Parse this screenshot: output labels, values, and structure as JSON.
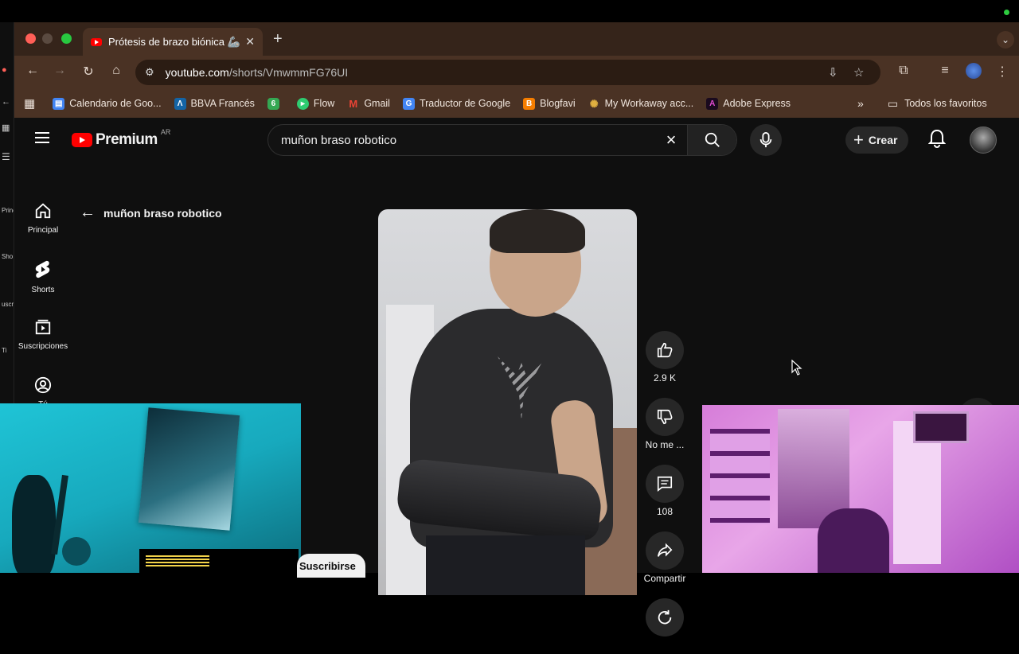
{
  "browser": {
    "tab_title": "Prótesis de brazo biónica 🦾",
    "tab_close": "✕",
    "new_tab": "+",
    "url_domain": "youtube.com",
    "url_path": "/shorts/VmwmmFG76UI"
  },
  "bookmarks": {
    "items": [
      {
        "label": "Calendario de Goo...",
        "icon": "calendar-icon",
        "color": "#4285f4"
      },
      {
        "label": "BBVA Francés",
        "icon": "bbva-icon",
        "color": "#1464a5"
      },
      {
        "label": "",
        "icon": "six-badge-icon",
        "color": "#34a853",
        "badge": "6"
      },
      {
        "label": "Flow",
        "icon": "flow-icon",
        "color": "#2ecc71"
      },
      {
        "label": "Gmail",
        "icon": "gmail-icon",
        "color": "#ea4335"
      },
      {
        "label": "Traductor de Google",
        "icon": "translate-icon",
        "color": "#4285f4"
      },
      {
        "label": "Blogfavi",
        "icon": "blogger-icon",
        "color": "#f57d00"
      },
      {
        "label": "My Workaway acc...",
        "icon": "workaway-icon",
        "color": "#e0b040"
      },
      {
        "label": "Adobe Express",
        "icon": "adobe-express-icon",
        "color": "#8b1d9c"
      }
    ],
    "more": "»",
    "all_favorites": "Todos los favoritos"
  },
  "youtube": {
    "logo_text": "Premium",
    "country_code": "AR",
    "search_query": "muñon braso robotico",
    "create_label": "Crear",
    "back_label": "muñon braso robotico",
    "guide": [
      {
        "label": "Principal",
        "icon": "home-icon"
      },
      {
        "label": "Shorts",
        "icon": "shorts-icon"
      },
      {
        "label": "Suscripciones",
        "icon": "subscriptions-icon"
      },
      {
        "label": "Tú",
        "icon": "you-icon"
      }
    ],
    "actions": {
      "like_count": "2.9 K",
      "dislike_label": "No me ...",
      "comments_count": "108",
      "share_label": "Compartir"
    },
    "subscribe_label": "Suscribirse"
  },
  "ghost_sidebar": [
    "Princ",
    "Sho",
    "uscrip",
    "Ti"
  ]
}
